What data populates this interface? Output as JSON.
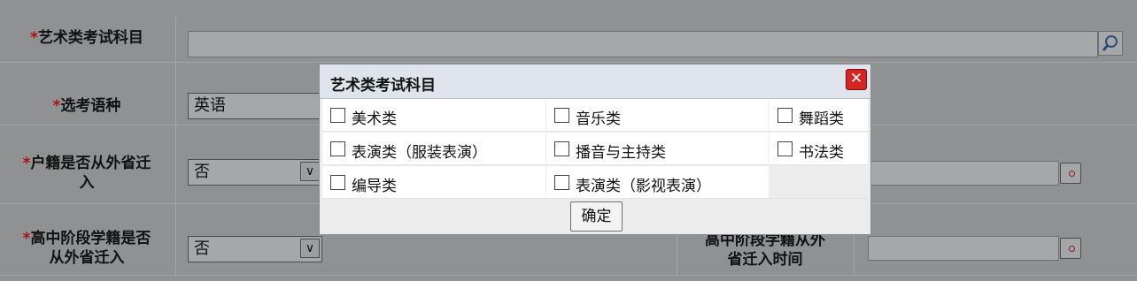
{
  "form": {
    "art_subject": {
      "required_mark": "*",
      "label": "艺术类考试科目"
    },
    "language": {
      "required_mark": "*",
      "label": "选考语种",
      "value": "英语"
    },
    "household": {
      "required_mark": "*",
      "label_line1": "户籍是否从外省迁",
      "label_line2": "入",
      "value": "否"
    },
    "school_status": {
      "required_mark": "*",
      "label_line1": "高中阶段学籍是否",
      "label_line2": "从外省迁入",
      "value": "否",
      "right_label_line1": "高中阶段学籍从外",
      "right_label_line2": "省迁入时间"
    }
  },
  "dialog": {
    "title": "艺术类考试科目",
    "close_glyph": "✕",
    "options": [
      "美术类",
      "音乐类",
      "舞蹈类",
      "表演类（服装表演）",
      "播音与主持类",
      "书法类",
      "编导类",
      "表演类（影视表演）"
    ],
    "confirm_label": "确定"
  }
}
